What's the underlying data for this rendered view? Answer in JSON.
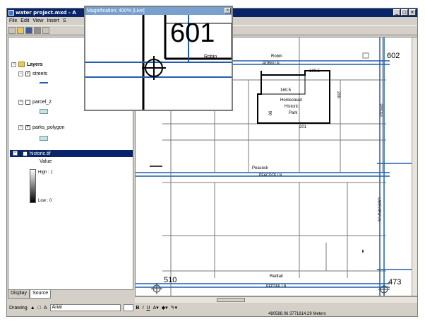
{
  "window": {
    "title": "water project.mxd - A",
    "controls": [
      "_",
      "□",
      "×"
    ]
  },
  "menu": [
    "File",
    "Edit",
    "View",
    "Insert",
    "S"
  ],
  "toc": {
    "root_label": "Layers",
    "layers": [
      {
        "name": "streets",
        "checked": true
      },
      {
        "name": "parcel_2",
        "checked": false
      },
      {
        "name": "parks_polygon",
        "checked": true
      },
      {
        "name": "historic.tif",
        "checked": true
      }
    ],
    "raster_value_label": "Value",
    "high_label": "High : 1",
    "low_label": "Low : 0",
    "tabs": [
      "Display",
      "Source"
    ]
  },
  "magnifier": {
    "title": "Magnification: 400% [Live]",
    "parcel_number": "601",
    "street_label": "Robin",
    "close_glyph": "×"
  },
  "map": {
    "labels": {
      "robin": "Robin",
      "robin_ln": "ROBIN LN",
      "parcel_602": "602",
      "parcel_1005": "100.5",
      "parcel_1605": "160.5",
      "park_name_line1": "Homestead",
      "park_name_line2": "Historic",
      "park_name_line3": "Park",
      "parcel_201": "201",
      "parcel_200": "200",
      "parcel_90": "90",
      "peacock": "Peacock",
      "peacock_ln": "PEACOCK LN",
      "redtail": "Redtail",
      "redtail_ln": "REDTAIL LN",
      "parcel_510": "510",
      "parcel_473": "473",
      "lakeview": "LAKEVIEW LN",
      "oriole": "ORIOLE"
    }
  },
  "drawing_toolbar": {
    "drawing_label": "Drawing",
    "font_name": "Arial",
    "text_tool": "A",
    "bold": "B",
    "italic": "I",
    "underline": "U"
  },
  "status": {
    "coords": "480588.06  3771614.29 Meters"
  },
  "colors": {
    "street": "#1f5fb0",
    "parcel": "#7a7a7a",
    "park": "#000000",
    "titlebar": "#0a246a",
    "magnifier_title": "#7aa0d0"
  }
}
